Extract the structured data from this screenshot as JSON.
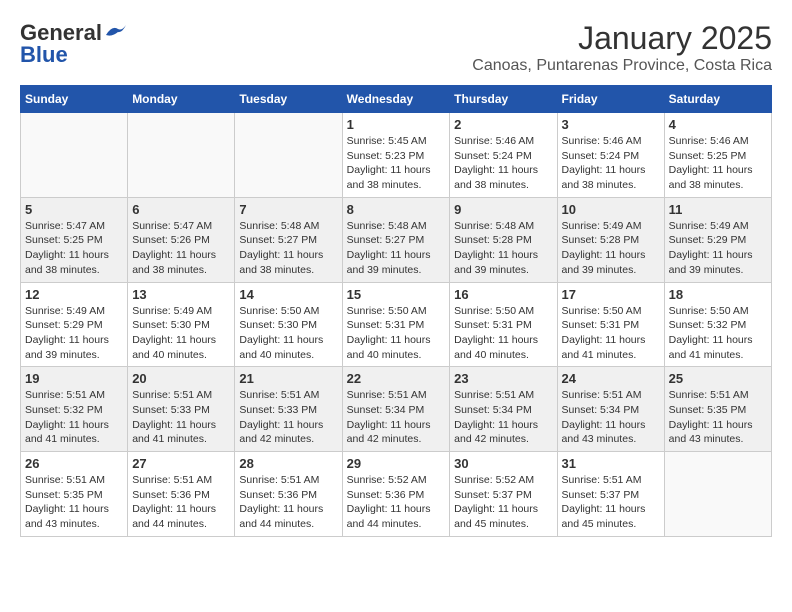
{
  "logo": {
    "general": "General",
    "blue": "Blue"
  },
  "title": "January 2025",
  "subtitle": "Canoas, Puntarenas Province, Costa Rica",
  "days_of_week": [
    "Sunday",
    "Monday",
    "Tuesday",
    "Wednesday",
    "Thursday",
    "Friday",
    "Saturday"
  ],
  "weeks": [
    [
      {
        "day": "",
        "sunrise": "",
        "sunset": "",
        "daylight": ""
      },
      {
        "day": "",
        "sunrise": "",
        "sunset": "",
        "daylight": ""
      },
      {
        "day": "",
        "sunrise": "",
        "sunset": "",
        "daylight": ""
      },
      {
        "day": "1",
        "sunrise": "Sunrise: 5:45 AM",
        "sunset": "Sunset: 5:23 PM",
        "daylight": "Daylight: 11 hours and 38 minutes."
      },
      {
        "day": "2",
        "sunrise": "Sunrise: 5:46 AM",
        "sunset": "Sunset: 5:24 PM",
        "daylight": "Daylight: 11 hours and 38 minutes."
      },
      {
        "day": "3",
        "sunrise": "Sunrise: 5:46 AM",
        "sunset": "Sunset: 5:24 PM",
        "daylight": "Daylight: 11 hours and 38 minutes."
      },
      {
        "day": "4",
        "sunrise": "Sunrise: 5:46 AM",
        "sunset": "Sunset: 5:25 PM",
        "daylight": "Daylight: 11 hours and 38 minutes."
      }
    ],
    [
      {
        "day": "5",
        "sunrise": "Sunrise: 5:47 AM",
        "sunset": "Sunset: 5:25 PM",
        "daylight": "Daylight: 11 hours and 38 minutes."
      },
      {
        "day": "6",
        "sunrise": "Sunrise: 5:47 AM",
        "sunset": "Sunset: 5:26 PM",
        "daylight": "Daylight: 11 hours and 38 minutes."
      },
      {
        "day": "7",
        "sunrise": "Sunrise: 5:48 AM",
        "sunset": "Sunset: 5:27 PM",
        "daylight": "Daylight: 11 hours and 38 minutes."
      },
      {
        "day": "8",
        "sunrise": "Sunrise: 5:48 AM",
        "sunset": "Sunset: 5:27 PM",
        "daylight": "Daylight: 11 hours and 39 minutes."
      },
      {
        "day": "9",
        "sunrise": "Sunrise: 5:48 AM",
        "sunset": "Sunset: 5:28 PM",
        "daylight": "Daylight: 11 hours and 39 minutes."
      },
      {
        "day": "10",
        "sunrise": "Sunrise: 5:49 AM",
        "sunset": "Sunset: 5:28 PM",
        "daylight": "Daylight: 11 hours and 39 minutes."
      },
      {
        "day": "11",
        "sunrise": "Sunrise: 5:49 AM",
        "sunset": "Sunset: 5:29 PM",
        "daylight": "Daylight: 11 hours and 39 minutes."
      }
    ],
    [
      {
        "day": "12",
        "sunrise": "Sunrise: 5:49 AM",
        "sunset": "Sunset: 5:29 PM",
        "daylight": "Daylight: 11 hours and 39 minutes."
      },
      {
        "day": "13",
        "sunrise": "Sunrise: 5:49 AM",
        "sunset": "Sunset: 5:30 PM",
        "daylight": "Daylight: 11 hours and 40 minutes."
      },
      {
        "day": "14",
        "sunrise": "Sunrise: 5:50 AM",
        "sunset": "Sunset: 5:30 PM",
        "daylight": "Daylight: 11 hours and 40 minutes."
      },
      {
        "day": "15",
        "sunrise": "Sunrise: 5:50 AM",
        "sunset": "Sunset: 5:31 PM",
        "daylight": "Daylight: 11 hours and 40 minutes."
      },
      {
        "day": "16",
        "sunrise": "Sunrise: 5:50 AM",
        "sunset": "Sunset: 5:31 PM",
        "daylight": "Daylight: 11 hours and 40 minutes."
      },
      {
        "day": "17",
        "sunrise": "Sunrise: 5:50 AM",
        "sunset": "Sunset: 5:31 PM",
        "daylight": "Daylight: 11 hours and 41 minutes."
      },
      {
        "day": "18",
        "sunrise": "Sunrise: 5:50 AM",
        "sunset": "Sunset: 5:32 PM",
        "daylight": "Daylight: 11 hours and 41 minutes."
      }
    ],
    [
      {
        "day": "19",
        "sunrise": "Sunrise: 5:51 AM",
        "sunset": "Sunset: 5:32 PM",
        "daylight": "Daylight: 11 hours and 41 minutes."
      },
      {
        "day": "20",
        "sunrise": "Sunrise: 5:51 AM",
        "sunset": "Sunset: 5:33 PM",
        "daylight": "Daylight: 11 hours and 41 minutes."
      },
      {
        "day": "21",
        "sunrise": "Sunrise: 5:51 AM",
        "sunset": "Sunset: 5:33 PM",
        "daylight": "Daylight: 11 hours and 42 minutes."
      },
      {
        "day": "22",
        "sunrise": "Sunrise: 5:51 AM",
        "sunset": "Sunset: 5:34 PM",
        "daylight": "Daylight: 11 hours and 42 minutes."
      },
      {
        "day": "23",
        "sunrise": "Sunrise: 5:51 AM",
        "sunset": "Sunset: 5:34 PM",
        "daylight": "Daylight: 11 hours and 42 minutes."
      },
      {
        "day": "24",
        "sunrise": "Sunrise: 5:51 AM",
        "sunset": "Sunset: 5:34 PM",
        "daylight": "Daylight: 11 hours and 43 minutes."
      },
      {
        "day": "25",
        "sunrise": "Sunrise: 5:51 AM",
        "sunset": "Sunset: 5:35 PM",
        "daylight": "Daylight: 11 hours and 43 minutes."
      }
    ],
    [
      {
        "day": "26",
        "sunrise": "Sunrise: 5:51 AM",
        "sunset": "Sunset: 5:35 PM",
        "daylight": "Daylight: 11 hours and 43 minutes."
      },
      {
        "day": "27",
        "sunrise": "Sunrise: 5:51 AM",
        "sunset": "Sunset: 5:36 PM",
        "daylight": "Daylight: 11 hours and 44 minutes."
      },
      {
        "day": "28",
        "sunrise": "Sunrise: 5:51 AM",
        "sunset": "Sunset: 5:36 PM",
        "daylight": "Daylight: 11 hours and 44 minutes."
      },
      {
        "day": "29",
        "sunrise": "Sunrise: 5:52 AM",
        "sunset": "Sunset: 5:36 PM",
        "daylight": "Daylight: 11 hours and 44 minutes."
      },
      {
        "day": "30",
        "sunrise": "Sunrise: 5:52 AM",
        "sunset": "Sunset: 5:37 PM",
        "daylight": "Daylight: 11 hours and 45 minutes."
      },
      {
        "day": "31",
        "sunrise": "Sunrise: 5:51 AM",
        "sunset": "Sunset: 5:37 PM",
        "daylight": "Daylight: 11 hours and 45 minutes."
      },
      {
        "day": "",
        "sunrise": "",
        "sunset": "",
        "daylight": ""
      }
    ]
  ]
}
